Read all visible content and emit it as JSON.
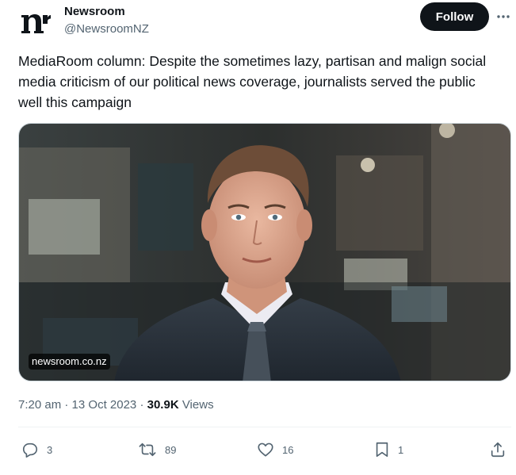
{
  "author": {
    "avatar_text": "n",
    "display_name": "Newsroom",
    "handle": "@NewsroomNZ"
  },
  "follow_label": "Follow",
  "more_icon": "more-horizontal-icon",
  "text": "MediaRoom column: Despite the sometimes lazy, partisan and malign social media criticism of our political news coverage, journalists served the public well this campaign",
  "media": {
    "domain_label": "newsroom.co.nz"
  },
  "meta": {
    "time": "7:20 am",
    "separator": "·",
    "date": "13 Oct 2023",
    "views_count": "30.9K",
    "views_label": "Views"
  },
  "actions": {
    "replies": "3",
    "reposts": "89",
    "likes": "16",
    "bookmarks": "1"
  },
  "icons": {
    "reply": "reply-icon",
    "repost": "repost-icon",
    "like": "heart-icon",
    "bookmark": "bookmark-icon",
    "share": "share-icon"
  },
  "colors": {
    "text_primary": "#0f1419",
    "text_secondary": "#536471",
    "follow_bg": "#0f1419",
    "border": "#cfd9de"
  }
}
